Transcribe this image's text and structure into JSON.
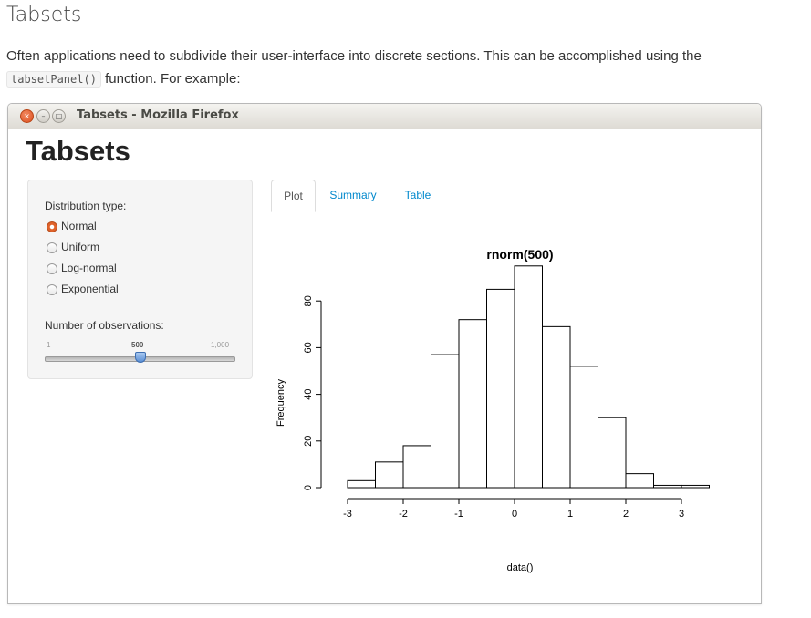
{
  "doc": {
    "heading": "Tabsets",
    "para_part1": "Often applications need to subdivide their user-interface into discrete sections. This can be accomplished using the",
    "code": "tabsetPanel()",
    "para_part2": "function. For example:"
  },
  "window": {
    "title": "Tabsets - Mozilla Firefox",
    "buttons": {
      "close": "×",
      "minimize": "–",
      "maximize": "□"
    }
  },
  "app": {
    "title": "Tabsets",
    "sidebar": {
      "dist_label": "Distribution type:",
      "options": [
        "Normal",
        "Uniform",
        "Log-normal",
        "Exponential"
      ],
      "selected": "Normal",
      "obs_label": "Number of observations:",
      "slider": {
        "min_label": "1",
        "value_label": "500",
        "max_label": "1,000",
        "value": 500,
        "min": 1,
        "max": 1000
      }
    },
    "tabs": [
      "Plot",
      "Summary",
      "Table"
    ],
    "active_tab": "Plot"
  },
  "colors": {
    "accent": "#0088cc",
    "radio_checked": "#e0622a",
    "slider_thumb": "#5b8fd4"
  },
  "chart_data": {
    "type": "bar",
    "title": "rnorm(500)",
    "xlabel": "data()",
    "ylabel": "Frequency",
    "bins": [
      [
        -3.5,
        -3
      ],
      [
        -3,
        -2.5
      ],
      [
        -2.5,
        -2
      ],
      [
        -2,
        -1.5
      ],
      [
        -1.5,
        -1
      ],
      [
        -1,
        -0.5
      ],
      [
        -0.5,
        0
      ],
      [
        0,
        0.5
      ],
      [
        0.5,
        1
      ],
      [
        1,
        1.5
      ],
      [
        1.5,
        2
      ],
      [
        2,
        2.5
      ],
      [
        2.5,
        3
      ],
      [
        3,
        3.5
      ]
    ],
    "values": [
      0,
      3,
      11,
      18,
      57,
      72,
      85,
      95,
      69,
      52,
      30,
      6,
      1,
      1
    ],
    "xticks": [
      "-3",
      "-2",
      "-1",
      "0",
      "1",
      "2",
      "3"
    ],
    "yticks": [
      "0",
      "20",
      "40",
      "60",
      "80"
    ],
    "xlim": [
      -3,
      3.5
    ],
    "ylim": [
      0,
      80
    ]
  }
}
